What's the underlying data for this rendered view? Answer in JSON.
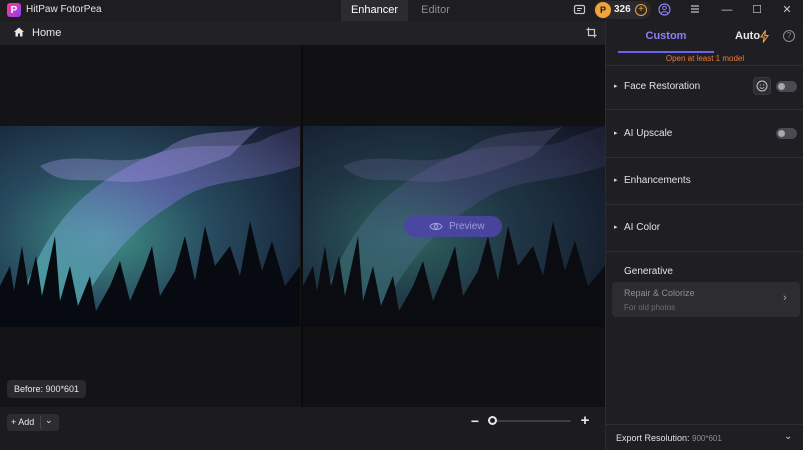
{
  "app": {
    "name": "HitPaw FotorPea",
    "logo_letter": "P"
  },
  "mode_tabs": [
    {
      "label": "Enhancer",
      "active": true
    },
    {
      "label": "Editor",
      "active": false
    }
  ],
  "credits": {
    "count": "326"
  },
  "window_controls": {
    "minimize": "—",
    "maximize": "☐",
    "close": "✕"
  },
  "canvas_bar": {
    "home_label": "Home"
  },
  "canvas": {
    "preview_label": "Preview",
    "before_badge": "Before: 900*601"
  },
  "bottom_bar": {
    "add_label": "+ Add",
    "add_caret": "⌄",
    "zoom_out": "−",
    "zoom_in": "+",
    "zoom_level": 0
  },
  "panel": {
    "tabs": [
      {
        "label": "Custom",
        "active": true
      },
      {
        "label": "Auto",
        "active": false
      }
    ],
    "help": "?",
    "warning": "Open at least 1 model",
    "models": [
      {
        "label": "Face Restoration",
        "caret": "▸",
        "toggle": false
      },
      {
        "label": "AI Upscale",
        "caret": "▸",
        "toggle": false
      },
      {
        "label": "Enhancements",
        "caret": "▸"
      },
      {
        "label": "AI Color",
        "caret": "▸"
      }
    ],
    "generative": {
      "title": "Generative",
      "card_title": "Repair & Colorize",
      "card_subtitle": "For old photos",
      "chevron": "›"
    },
    "export": {
      "label": "Export Resolution:",
      "value": "900*601",
      "chevron": "⌄"
    }
  },
  "colors": {
    "accent": "#6d61f0",
    "warning": "#f07a3a",
    "credit_coin": "#f2a33a"
  }
}
